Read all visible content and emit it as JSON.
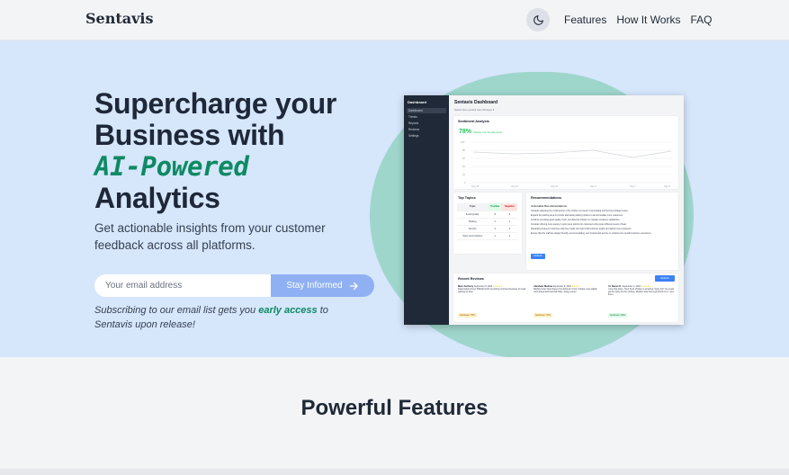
{
  "brand": "Sentavis",
  "nav": {
    "links": [
      "Features",
      "How It Works",
      "FAQ"
    ],
    "theme_icon": "moon-icon"
  },
  "hero": {
    "headline_1": "Supercharge your",
    "headline_2": "Business with",
    "headline_ai": "AI-Powered",
    "headline_3": "Analytics",
    "subtitle": "Get actionable insights from your customer feedback across all platforms.",
    "email_placeholder": "Your email address",
    "button_label": "Stay Informed",
    "note_before": "Subscribing to our email list gets you ",
    "note_highlight": "early access",
    "note_after": " to Sentavis upon release!"
  },
  "dashboard": {
    "sidebar_title": "Dashboard",
    "sidebar_items": [
      "Dashboard",
      "Trends",
      "Reports",
      "Reviews",
      "Settings"
    ],
    "title": "Sentavis Dashboard",
    "filter": "Select time period   Last 30 days ▾",
    "sentiment_title": "Sentiment Analysis",
    "sentiment_pct": "78%",
    "sentiment_label": "Positive over the last period",
    "x_ticks": [
      "Aug 18",
      "Aug 21",
      "Aug 31",
      "Sep 3",
      "Sep 7",
      "Sep 9"
    ],
    "y_ticks": [
      "100",
      "80",
      "60",
      "40",
      "20",
      "0"
    ],
    "topics_title": "Top Topics",
    "topics_headers": [
      "Topic",
      "Positive",
      "Negative"
    ],
    "topics_rows": [
      [
        "Food Quality",
        "8",
        "2"
      ],
      [
        "Parking",
        "1",
        "1"
      ],
      [
        "Service",
        "4",
        "3"
      ],
      [
        "Spicy level Options",
        "1",
        "4"
      ]
    ],
    "rec_title": "Recommendations",
    "rec_subtitle": "Actionable Recommendations",
    "rec_items": [
      "Consider adjusting the cooking time of the chicken to prevent overcooking and burning cottage texture.",
      "Expand the parking area to provide alternative parking options to accommodate more customers.",
      "Continue providing good quality, fresh, and flavorful chicken to maintain customer satisfaction.",
      "Consider offering more variety in spicy level options for customers who prefer different levels of heat.",
      "Rewarding frequent customers with free meals can help build customer loyalty and attract new customers.",
      "Ensure that the staff are always friendly, accommodating, and provide fast service to enhance the overall customer experience."
    ],
    "rec_button": "Refresh",
    "reviews_title": "Recent Reviews",
    "reviews_button": "Refresh",
    "reviews": [
      {
        "name": "Marc Anthony",
        "date": "September 8, 2024",
        "text": "Reasonably priced. BIGGE food but parking is limited because of small parking lot area.",
        "tag": "Sentiment: 75%"
      },
      {
        "name": "Abraham Medina",
        "date": "September 8, 2024",
        "text": "Slightly better than Dave's but still kind of mid. Chicken was slightly overcooked and had that bitter, stingy texture.",
        "tag": "Sentiment: 70%"
      },
      {
        "name": "Yo Daven K.",
        "date": "September 2, 2024",
        "text": "I love this place. Their fresh chicken is amazing. Spicy hot! You could get the spicy but for nothing. Medium also has a good kick to it. I love them.",
        "tag": "Sentiment: 94%"
      }
    ]
  },
  "features_title": "Powerful Features"
}
